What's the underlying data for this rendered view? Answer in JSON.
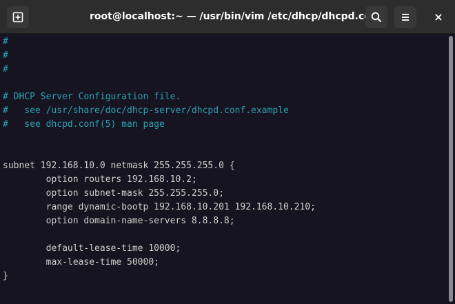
{
  "window": {
    "title": "root@localhost:~ — /usr/bin/vim /etc/dhcp/dhcpd.conf"
  },
  "header": {
    "new_tab_icon": "new-tab-icon",
    "search_icon": "search-icon",
    "menu_icon": "hamburger-menu-icon",
    "close_icon": "close-icon"
  },
  "editor": {
    "lines": [
      {
        "text": "#",
        "kind": "comment"
      },
      {
        "text": "#",
        "kind": "comment"
      },
      {
        "text": "#",
        "kind": "comment"
      },
      {
        "text": "",
        "kind": "blank"
      },
      {
        "text": "# DHCP Server Configuration file.",
        "kind": "comment"
      },
      {
        "text": "#   see /usr/share/doc/dhcp-server/dhcpd.conf.example",
        "kind": "comment"
      },
      {
        "text": "#   see dhcpd.conf(5) man page",
        "kind": "comment"
      },
      {
        "text": "",
        "kind": "blank"
      },
      {
        "text": "",
        "kind": "blank"
      },
      {
        "text": "subnet 192.168.10.0 netmask 255.255.255.0 {",
        "kind": "code"
      },
      {
        "text": "        option routers 192.168.10.2;",
        "kind": "code"
      },
      {
        "text": "        option subnet-mask 255.255.255.0;",
        "kind": "code"
      },
      {
        "text": "        range dynamic-bootp 192.168.10.201 192.168.10.210;",
        "kind": "code"
      },
      {
        "text": "        option domain-name-servers 8.8.8.8;",
        "kind": "code"
      },
      {
        "text": "",
        "kind": "blank"
      },
      {
        "text": "        default-lease-time 10000;",
        "kind": "code"
      },
      {
        "text": "        max-lease-time 50000;",
        "kind": "code"
      },
      {
        "text": "}",
        "kind": "code"
      }
    ]
  },
  "colors": {
    "background": "#171421",
    "titlebar": "#2d2d2d",
    "comment": "#2aa1b3",
    "text": "#d0cfcc"
  }
}
